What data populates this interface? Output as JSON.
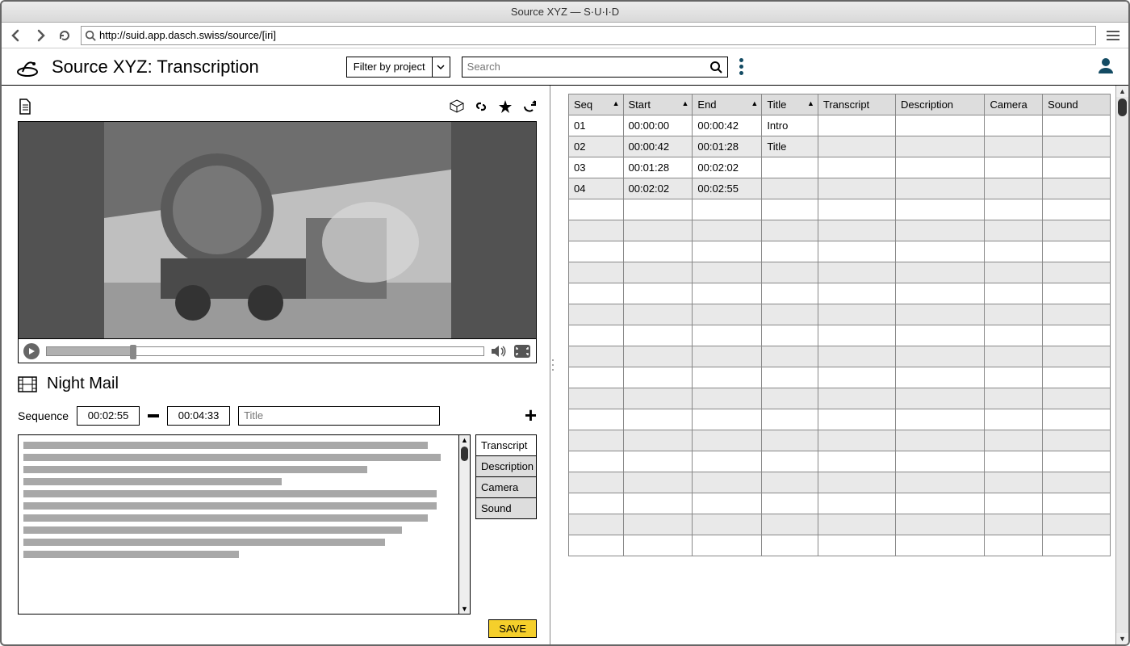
{
  "window": {
    "title": "Source XYZ — S·U·I·D"
  },
  "browser": {
    "url": "http://suid.app.dasch.swiss/source/[iri]"
  },
  "header": {
    "title": "Source XYZ: Transcription",
    "filter_label": "Filter by project",
    "search_placeholder": "Search"
  },
  "video": {
    "progress_percent": 19
  },
  "film": {
    "title": "Night Mail"
  },
  "sequence": {
    "label": "Sequence",
    "start": "00:02:55",
    "end": "00:04:33",
    "title_placeholder": "Title"
  },
  "editor_tabs": {
    "items": [
      {
        "label": "Transcript",
        "active": true
      },
      {
        "label": "Description",
        "active": false
      },
      {
        "label": "Camera",
        "active": false
      },
      {
        "label": "Sound",
        "active": false
      }
    ]
  },
  "save_label": "SAVE",
  "table": {
    "columns": [
      {
        "label": "Seq",
        "sortable": true
      },
      {
        "label": "Start",
        "sortable": true
      },
      {
        "label": "End",
        "sortable": true
      },
      {
        "label": "Title",
        "sortable": true
      },
      {
        "label": "Transcript",
        "sortable": false
      },
      {
        "label": "Description",
        "sortable": false
      },
      {
        "label": "Camera",
        "sortable": false
      },
      {
        "label": "Sound",
        "sortable": false
      }
    ],
    "rows": [
      {
        "seq": "01",
        "start": "00:00:00",
        "end": "00:00:42",
        "title": "Intro",
        "transcript": "",
        "description": "",
        "camera": "",
        "sound": ""
      },
      {
        "seq": "02",
        "start": "00:00:42",
        "end": "00:01:28",
        "title": "Title",
        "transcript": "",
        "description": "",
        "camera": "",
        "sound": ""
      },
      {
        "seq": "03",
        "start": "00:01:28",
        "end": "00:02:02",
        "title": "",
        "transcript": "",
        "description": "",
        "camera": "",
        "sound": ""
      },
      {
        "seq": "04",
        "start": "00:02:02",
        "end": "00:02:55",
        "title": "",
        "transcript": "",
        "description": "",
        "camera": "",
        "sound": ""
      }
    ],
    "empty_rows": 17
  }
}
